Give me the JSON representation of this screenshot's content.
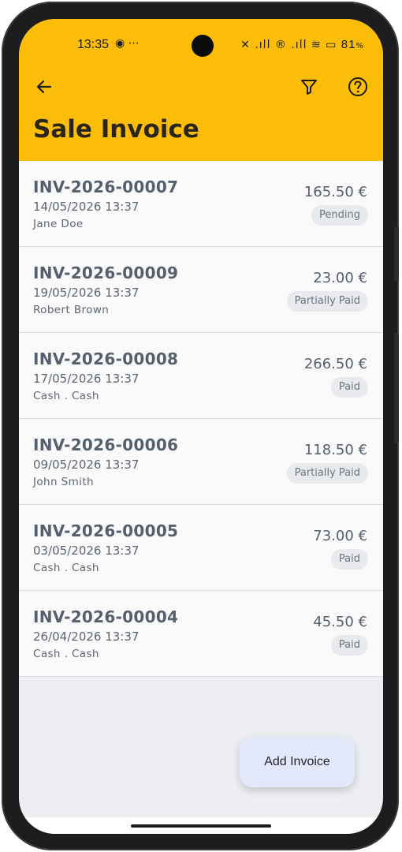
{
  "status_bar": {
    "time": "13:35",
    "extra": "◉ ⋯",
    "icons": "✕ .ıll ® .ıll ≋ ▭",
    "battery": "81",
    "battery_suffix": "%"
  },
  "header": {
    "title": "Sale Invoice",
    "back_icon": "arrow-left-icon",
    "filter_icon": "filter-icon",
    "help_icon": "help-icon"
  },
  "invoices": [
    {
      "number": "INV-2026-00007",
      "date": "14/05/2026 13:37",
      "customer": "Jane Doe",
      "amount": "165.50 €",
      "status": "Pending"
    },
    {
      "number": "INV-2026-00009",
      "date": "19/05/2026 13:37",
      "customer": "Robert Brown",
      "amount": "23.00 €",
      "status": "Partially Paid"
    },
    {
      "number": "INV-2026-00008",
      "date": "17/05/2026 13:37",
      "customer": "Cash . Cash",
      "amount": "266.50 €",
      "status": "Paid"
    },
    {
      "number": "INV-2026-00006",
      "date": "09/05/2026 13:37",
      "customer": "John Smith",
      "amount": "118.50 €",
      "status": "Partially Paid"
    },
    {
      "number": "INV-2026-00005",
      "date": "03/05/2026 13:37",
      "customer": "Cash . Cash",
      "amount": "73.00 €",
      "status": "Paid"
    },
    {
      "number": "INV-2026-00004",
      "date": "26/04/2026 13:37",
      "customer": "Cash . Cash",
      "amount": "45.50 €",
      "status": "Paid"
    }
  ],
  "fab": {
    "label": "Add Invoice"
  },
  "colors": {
    "accent": "#fbbd08",
    "row_background": "#fafafa",
    "page_background": "#eceef1",
    "fab_background": "#e3e9fb"
  }
}
